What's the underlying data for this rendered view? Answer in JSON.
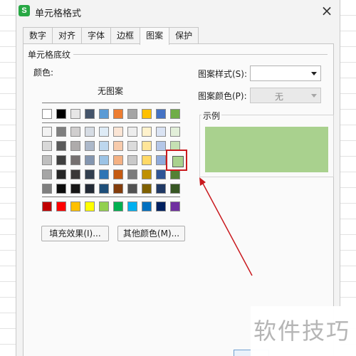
{
  "dialog": {
    "title": "单元格格式",
    "app_icon_letter": "S",
    "close_glyph": "×"
  },
  "tabs": [
    {
      "label": "数字"
    },
    {
      "label": "对齐"
    },
    {
      "label": "字体"
    },
    {
      "label": "边框"
    },
    {
      "label": "图案",
      "active": true
    },
    {
      "label": "保护"
    }
  ],
  "shading": {
    "group_title": "单元格底纹",
    "color_label": "颜色:",
    "no_pattern": "无图案",
    "palette": [
      [
        "#ffffff",
        "#000000",
        "#e7e6e6",
        "#44546a",
        "#5b9bd5",
        "#ed7d31",
        "#a5a5a5",
        "#ffc000",
        "#4472c4",
        "#70ad47"
      ],
      [
        "#f2f2f2",
        "#7f7f7f",
        "#d0cece",
        "#d6dce4",
        "#deebf6",
        "#fbe5d5",
        "#ededed",
        "#fff2cc",
        "#dae3f3",
        "#e2efd9"
      ],
      [
        "#d8d8d8",
        "#595959",
        "#aeabab",
        "#adb9ca",
        "#bdd7ee",
        "#f7cbac",
        "#dbdbdb",
        "#fee599",
        "#b4c6e7",
        "#c5e0b3"
      ],
      [
        "#bfbfbf",
        "#3f3f3f",
        "#757070",
        "#8496b0",
        "#9cc3e5",
        "#f4b183",
        "#c9c9c9",
        "#ffd966",
        "#8eaadb",
        "#a9d18e"
      ],
      [
        "#a5a5a5",
        "#262626",
        "#3a3838",
        "#323f4f",
        "#2e75b5",
        "#c55a11",
        "#7b7b7b",
        "#bf9000",
        "#2f5496",
        "#538135"
      ],
      [
        "#7f7f7f",
        "#0c0c0c",
        "#171616",
        "#222a35",
        "#1e4e79",
        "#833c0b",
        "#525252",
        "#7f6000",
        "#1f3864",
        "#375623"
      ]
    ],
    "standard_colors": [
      "#c00000",
      "#ff0000",
      "#ffc000",
      "#ffff00",
      "#92d050",
      "#00b050",
      "#00b0f0",
      "#0070c0",
      "#002060",
      "#7030a0"
    ],
    "selected_color": "#a9d18e",
    "fill_effects_button": "填充效果(I)...",
    "more_colors_button": "其他颜色(M)..."
  },
  "pattern": {
    "style_label": "图案样式(S):",
    "style_value": "",
    "color_label": "图案颜色(P):",
    "color_value": "无"
  },
  "sample": {
    "title": "示例",
    "fill_color": "#a9d18e"
  },
  "watermark": {
    "text": "软件技巧"
  },
  "annotation_color": "#c9191e"
}
